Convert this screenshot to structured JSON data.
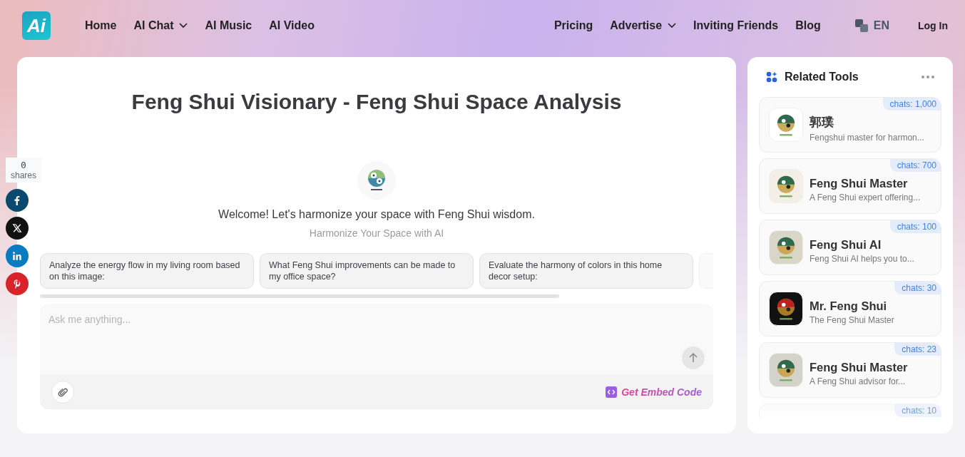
{
  "logo": {
    "text": "Ai"
  },
  "nav_left": [
    {
      "label": "Home",
      "dropdown": false
    },
    {
      "label": "AI Chat",
      "dropdown": true
    },
    {
      "label": "AI Music",
      "dropdown": false
    },
    {
      "label": "AI Video",
      "dropdown": false
    }
  ],
  "nav_right": [
    {
      "label": "Pricing",
      "dropdown": false
    },
    {
      "label": "Advertise",
      "dropdown": true
    },
    {
      "label": "Inviting Friends",
      "dropdown": false
    },
    {
      "label": "Blog",
      "dropdown": false
    }
  ],
  "language": "EN",
  "login": "Log In",
  "share": {
    "count": "0",
    "label": "shares",
    "buttons": [
      {
        "kind": "facebook"
      },
      {
        "kind": "x"
      },
      {
        "kind": "linkedin"
      },
      {
        "kind": "pinterest"
      }
    ]
  },
  "title": "Feng Shui Visionary - Feng Shui Space Analysis",
  "welcome": "Welcome! Let's harmonize your space with Feng Shui wisdom.",
  "tagline": "Harmonize Your Space with AI",
  "suggestions": [
    "Analyze the energy flow in my living room based on this image:",
    "What Feng Shui improvements can be made to my office space?",
    "Evaluate the harmony of colors in this home decor setup:"
  ],
  "input": {
    "placeholder": "Ask me anything..."
  },
  "embed": "Get Embed Code",
  "related": {
    "title": "Related Tools",
    "tools": [
      {
        "name": "郭璞",
        "desc": "Fengshui master for harmon...",
        "chats": "chats: 1,000"
      },
      {
        "name": "Feng Shui Master",
        "desc": "A Feng Shui expert offering...",
        "chats": "chats: 700"
      },
      {
        "name": "Feng Shui AI",
        "desc": "Feng Shui AI helps you to...",
        "chats": "chats: 100"
      },
      {
        "name": "Mr. Feng Shui",
        "desc": "The Feng Shui Master",
        "chats": "chats: 30"
      },
      {
        "name": "Feng Shui Master",
        "desc": "A Feng Shui advisor for...",
        "chats": "chats: 23"
      },
      {
        "chats": "chats: 10"
      }
    ]
  }
}
